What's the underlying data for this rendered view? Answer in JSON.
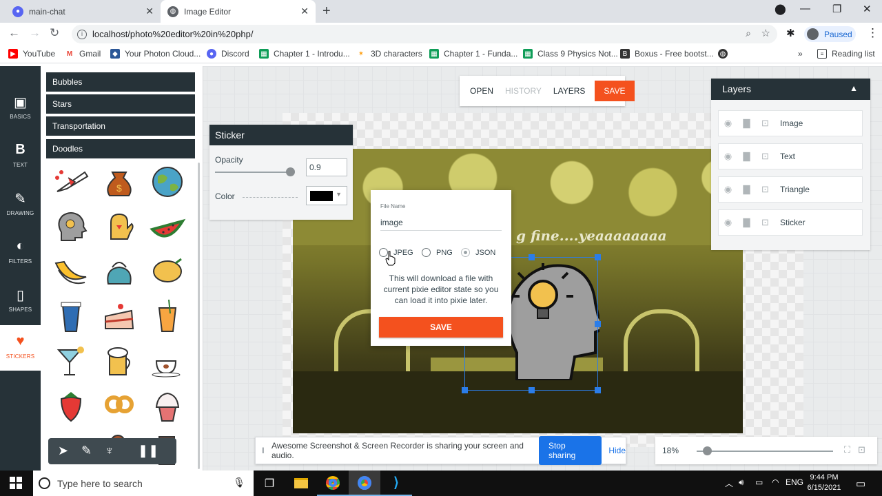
{
  "browser": {
    "tabs": [
      {
        "title": "main-chat",
        "close": "✕"
      },
      {
        "title": "Image Editor",
        "close": "✕"
      }
    ],
    "new_tab": "+",
    "url": "localhost/photo%20editor%20in%20php/",
    "profile_status": "Paused",
    "bookmarks": [
      {
        "label": "YouTube",
        "color": "#ff0000"
      },
      {
        "label": "Gmail",
        "color": "#ea4335"
      },
      {
        "label": "Your Photon Cloud...",
        "color": "#2b5797"
      },
      {
        "label": "Discord",
        "color": "#5865f2"
      },
      {
        "label": "Chapter 1 - Introdu...",
        "color": "#0f9d58"
      },
      {
        "label": "3D characters",
        "color": "#ff9800"
      },
      {
        "label": "Chapter 1 - Funda...",
        "color": "#0f9d58"
      },
      {
        "label": "Class 9 Physics Not...",
        "color": "#0f9d58"
      },
      {
        "label": "Boxus - Free bootst...",
        "color": "#333333"
      }
    ],
    "more_bookmarks": "»",
    "reading_list": "Reading list"
  },
  "nav": [
    {
      "label": "BASICS",
      "icon": "image-icon"
    },
    {
      "label": "TEXT",
      "icon": "text-icon"
    },
    {
      "label": "DRAWING",
      "icon": "brush-icon"
    },
    {
      "label": "FILTERS",
      "icon": "filters-icon"
    },
    {
      "label": "SHAPES",
      "icon": "shapes-icon"
    },
    {
      "label": "STICKERS",
      "icon": "heart-icon"
    }
  ],
  "categories": [
    "Bubbles",
    "Stars",
    "Transportation",
    "Doodles"
  ],
  "stickers": [
    "airplane-sticker",
    "money-bag-sticker",
    "globe-sticker",
    "head-idea-sticker",
    "oven-mitt-sticker",
    "watermelon-sticker",
    "banana-sticker",
    "kettle-sticker",
    "lemon-sticker",
    "coffee-cup-sticker",
    "cake-sticker",
    "juice-sticker",
    "cocktail-sticker",
    "beer-mug-sticker",
    "coffee-tea-sticker",
    "strawberry-sticker",
    "pretzel-sticker",
    "cupcake-sticker",
    "ice-cream-sticker",
    "chocolate-sticker"
  ],
  "topbar": {
    "open": "OPEN",
    "history": "HISTORY",
    "layers": "LAYERS",
    "save": "SAVE"
  },
  "sticker_panel": {
    "title": "Sticker",
    "opacity_label": "Opacity",
    "opacity_value": "0.9",
    "opacity": 0.9,
    "color_label": "Color",
    "color": "#000000"
  },
  "layers": {
    "title": "Layers",
    "items": [
      "Image",
      "Text",
      "Triangle",
      "Sticker"
    ]
  },
  "canvas": {
    "overlay_text": "g fine....yeaaaaaaaa"
  },
  "dialog": {
    "file_name_label": "File Name",
    "file_name": "image",
    "formats": [
      "JPEG",
      "PNG",
      "JSON"
    ],
    "selected_format": "JSON",
    "description": "This will download a file with current pixie editor state so you can load it into pixie later.",
    "save": "SAVE"
  },
  "sharebar": {
    "message": "Awesome Screenshot & Screen Recorder is sharing your screen and audio.",
    "stop": "Stop sharing",
    "hide": "Hide"
  },
  "zoom": {
    "value": "18%"
  },
  "taskbar": {
    "search_placeholder": "Type here to search",
    "lang": "ENG",
    "time": "9:44 PM",
    "date": "6/15/2021"
  }
}
